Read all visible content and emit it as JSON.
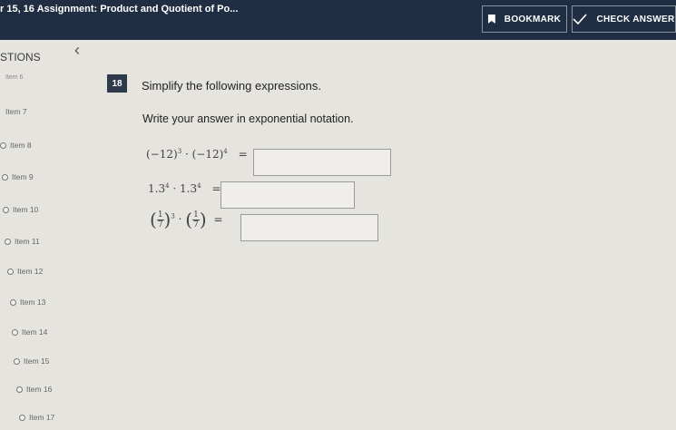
{
  "header": {
    "title": "r 15, 16 Assignment: Product and Quotient of Po...",
    "bookmark_label": "BOOKMARK",
    "check_label": "CHECK ANSWER"
  },
  "sidebar": {
    "title": "STIONS",
    "partial_item": "Item 6",
    "items": [
      "Item 7",
      "Item 8",
      "Item 9",
      "Item 10",
      "Item 11",
      "Item 12",
      "Item 13",
      "Item 14",
      "Item 15",
      "Item 16",
      "Item 17"
    ]
  },
  "question": {
    "number": "18",
    "prompt": "Simplify the following expressions.",
    "instruction": "Write your answer in exponential notation.",
    "expr1": {
      "base": "(−12)",
      "exp1": "3",
      "dot": " · ",
      "base2": "(−12)",
      "exp2": "4",
      "eq": "="
    },
    "expr2": {
      "base": "1.3",
      "exp1": "4",
      "dot": " · ",
      "base2": "1.3",
      "exp2": "4",
      "eq": "="
    },
    "expr3": {
      "num": "1",
      "den": "7",
      "exp1": "3",
      "dot": " · ",
      "num2": "1",
      "den2": "7",
      "eq": "="
    }
  },
  "colors": {
    "topbar": "#1f2e42",
    "badge": "#2e3a49",
    "background": "#e6e4df"
  }
}
